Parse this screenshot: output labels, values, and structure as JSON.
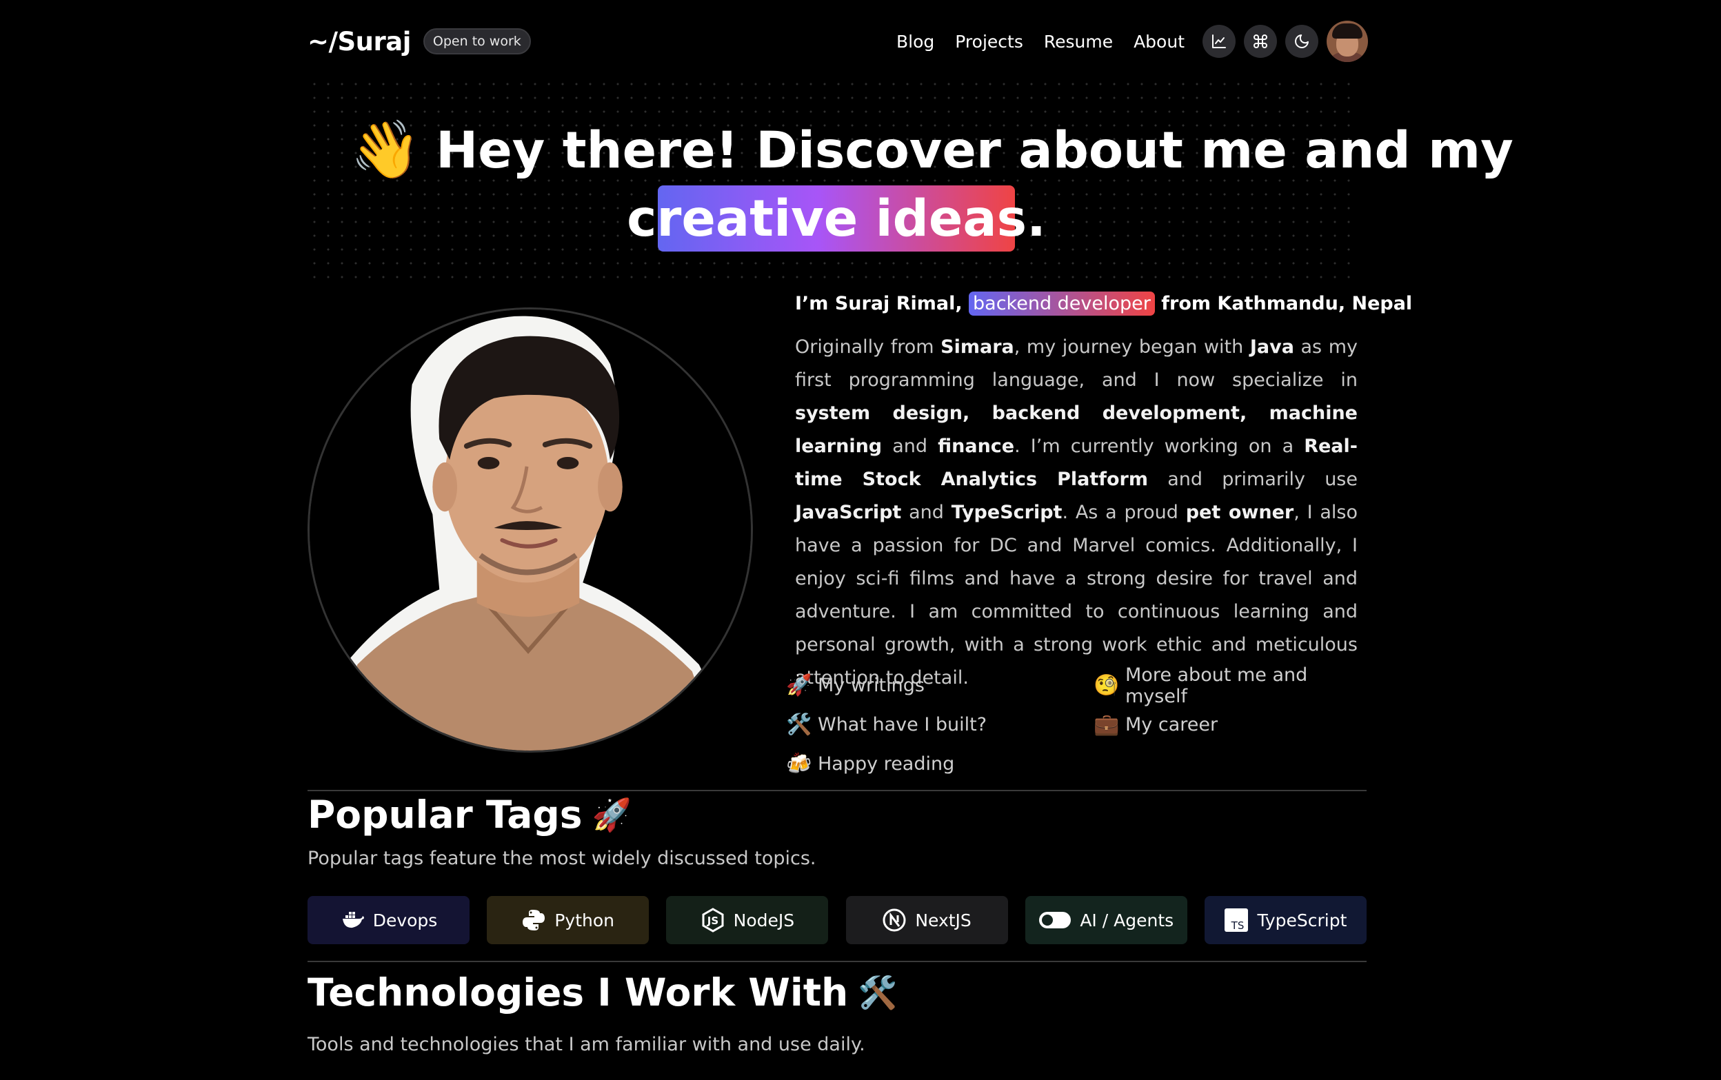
{
  "header": {
    "logo": "~/Suraj",
    "status_badge": "Open to work",
    "nav": [
      "Blog",
      "Projects",
      "Resume",
      "About"
    ],
    "icons": [
      "chart-icon",
      "command-icon",
      "moon-icon"
    ]
  },
  "hero": {
    "emoji": "👋",
    "line1": "Hey there! Discover about me and my",
    "line2": "creative ideas."
  },
  "intro": {
    "prefix": "I’m Suraj Rimal,",
    "highlight": "backend developer",
    "suffix": "from Kathmandu, Nepal"
  },
  "bio": {
    "t1": "Originally from ",
    "b1": "Simara",
    "t2": ", my journey began with ",
    "b2": "Java",
    "t3": " as my first programming language, and I now specialize in ",
    "b3": "system design, backend development, machine learning",
    "t4": " and ",
    "b4": "finance",
    "t5": ". I’m currently working on a ",
    "b5": "Real-time Stock Analytics Platform",
    "t6": " and primarily use ",
    "b6": "JavaScript",
    "t7": " and ",
    "b7": "TypeScript",
    "t8": ". As a proud ",
    "b8": "pet owner",
    "t9": ", I also have a passion for DC and Marvel comics. Additionally, I enjoy sci-fi films and have a strong desire for travel and adventure. I am committed to continuous learning and personal growth, with a strong work ethic and meticulous attention to detail."
  },
  "quick_links": [
    {
      "emoji": "🚀",
      "label": "My writings"
    },
    {
      "emoji": "🧐",
      "label": "More about me and myself"
    },
    {
      "emoji": "🛠️",
      "label": "What have I built?"
    },
    {
      "emoji": "💼",
      "label": "My career"
    },
    {
      "emoji": "🍻",
      "label": "Happy reading"
    }
  ],
  "popular_tags": {
    "title": "Popular Tags",
    "emoji": "🚀",
    "subtitle": "Popular tags feature the most widely discussed topics.",
    "tags": [
      {
        "label": "Devops",
        "icon": "docker-icon",
        "bg": "#141433"
      },
      {
        "label": "Python",
        "icon": "python-icon",
        "bg": "#2a2412"
      },
      {
        "label": "NodeJS",
        "icon": "nodejs-icon",
        "bg": "#142018"
      },
      {
        "label": "NextJS",
        "icon": "nextjs-icon",
        "bg": "#1c1c1e"
      },
      {
        "label": "AI / Agents",
        "icon": "toggle-icon",
        "bg": "#13241e"
      },
      {
        "label": "TypeScript",
        "icon": "typescript-icon",
        "bg": "#111833"
      }
    ]
  },
  "technologies": {
    "title": "Technologies I Work With",
    "emoji": "🛠️",
    "subtitle": "Tools and technologies that I am familiar with and use daily."
  }
}
